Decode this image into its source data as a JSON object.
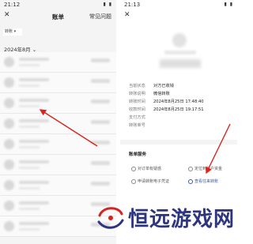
{
  "left": {
    "status_time": "21:12",
    "status_icons": "▮ ▮",
    "close_glyph": "✕",
    "title": "账单",
    "help": "常见问题",
    "filter_chip": "转账 ▾",
    "month": "2024年8月 ⌄"
  },
  "right": {
    "status_time": "21:13",
    "status_icons": "▮ ▮",
    "close_glyph": "✕",
    "details": [
      {
        "key": "当前状态",
        "value": "对方已收钱"
      },
      {
        "key": "转账说明",
        "value": "微信转账"
      },
      {
        "key": "转账时间",
        "value": "2024年8月25日 17:48:40"
      },
      {
        "key": "收款时间",
        "value": "2024年8月25日 19:17:51"
      },
      {
        "key": "支付方式",
        "value": ""
      },
      {
        "key": "转账单号",
        "value": ""
      }
    ],
    "services_title": "账单服务",
    "services": {
      "dispute": "对订单有疑惑",
      "recurring": "定位到账户资金",
      "voucher": "申请转账电子凭证",
      "view_all": "查看往来转账"
    }
  },
  "watermark": {
    "text": "恒远游戏网",
    "color": "#2d3580",
    "accent": "#d8241c"
  },
  "colors": {
    "arrow": "#d8241c",
    "link": "#3a5ba8"
  }
}
